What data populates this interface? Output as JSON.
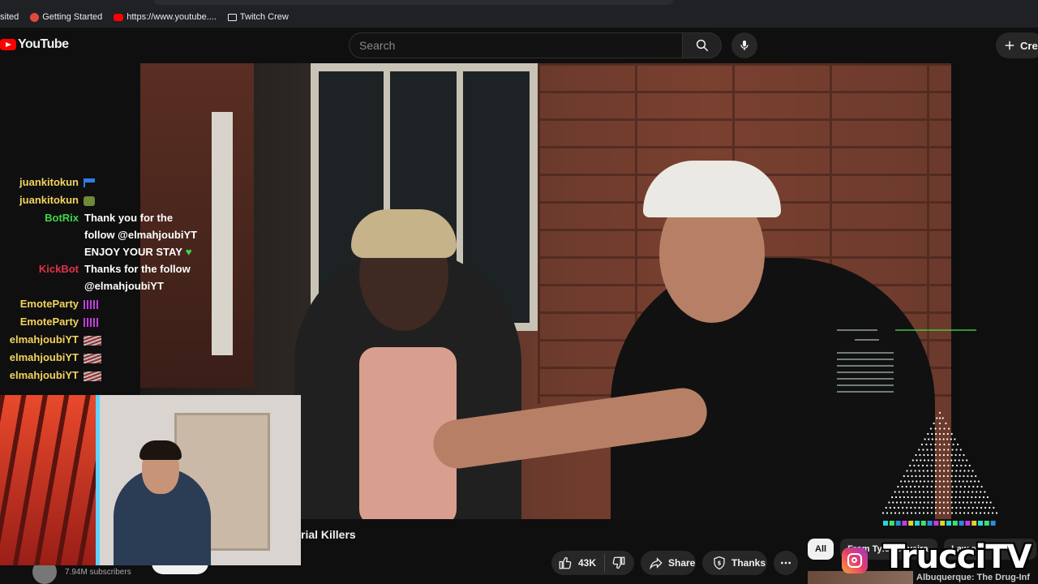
{
  "bookmarks": {
    "partial_left": "sited",
    "items": [
      {
        "label": "Getting Started"
      },
      {
        "label": "https://www.youtube...."
      },
      {
        "label": "Twitch Crew"
      }
    ]
  },
  "header": {
    "logo_text": "YouTube",
    "search_placeholder": "Search",
    "create_label": "Crea"
  },
  "chat": [
    {
      "user": "juankitokun",
      "color": "#f4d35e",
      "emote": "flag"
    },
    {
      "user": "juankitokun",
      "color": "#f4d35e",
      "emote": "bear"
    },
    {
      "user": "BotRix",
      "color": "#3fd64a",
      "lines": [
        "Thank you for the",
        "follow @elmahjoubiYT",
        "ENJOY YOUR STAY"
      ]
    },
    {
      "user": "KickBot",
      "color": "#e0324a",
      "lines": [
        "Thanks for the follow",
        "@elmahjoubiYT"
      ]
    },
    {
      "user": "EmoteParty",
      "color": "#f4d35e",
      "emote": "bars"
    },
    {
      "user": "EmoteParty",
      "color": "#f4d35e",
      "emote": "bars"
    },
    {
      "user": "elmahjoubiYT",
      "color": "#f4d35e",
      "emote": "cat"
    },
    {
      "user": "elmahjoubiYT",
      "color": "#f4d35e",
      "emote": "cat"
    },
    {
      "user": "elmahjoubiYT",
      "color": "#f4d35e",
      "emote": "cat"
    }
  ],
  "video": {
    "title_partial": "rial Killers",
    "subscribers": "7.94M subscribers"
  },
  "actions": {
    "likes": "43K",
    "share": "Share",
    "thanks": "Thanks"
  },
  "chips": [
    {
      "label": "All"
    },
    {
      "label": "From Tyler Oliveira"
    },
    {
      "label": "Law en"
    }
  ],
  "next_video_title": "Albuquerque: The Drug-Infeste",
  "watermark": "TrucciTV"
}
